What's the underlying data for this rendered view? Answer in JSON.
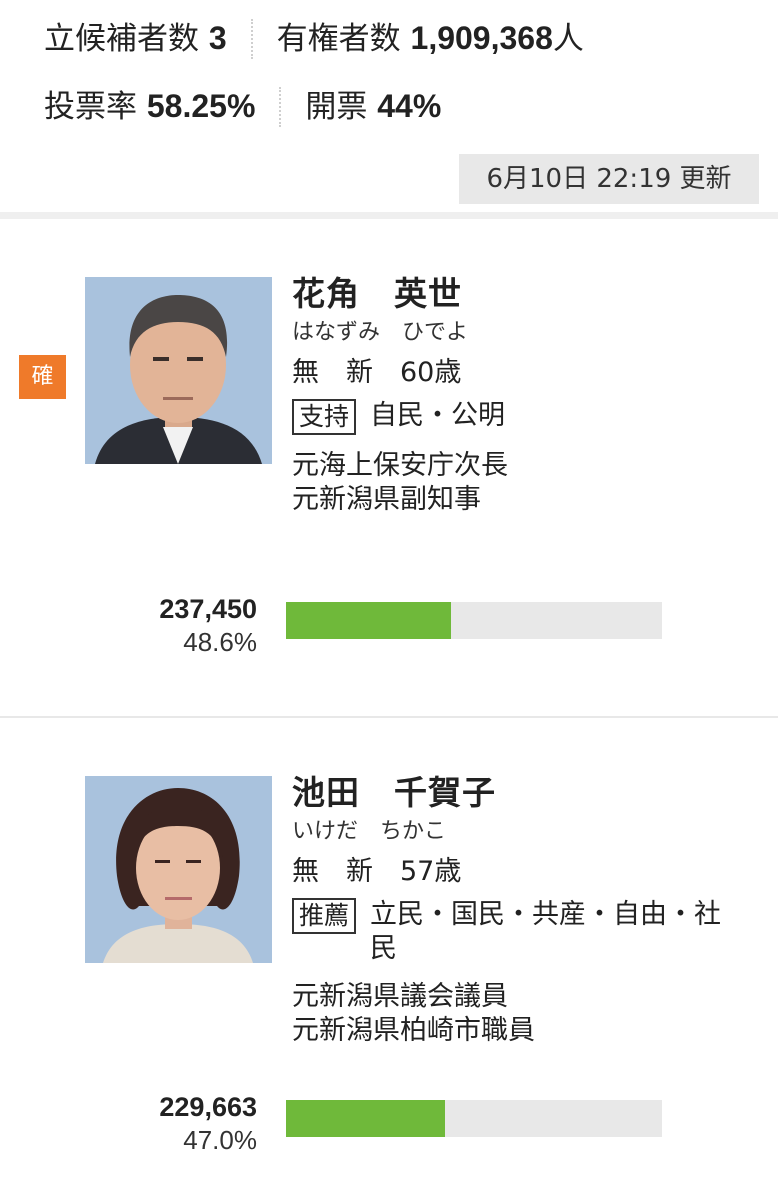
{
  "stats": {
    "candidates_label": "立候補者数",
    "candidates_value": "3",
    "voters_label": "有権者数",
    "voters_value": "1,909,368",
    "voters_unit": "人",
    "turnout_label": "投票率",
    "turnout_value": "58.25%",
    "counted_label": "開票",
    "counted_value": "44%"
  },
  "updated": "6月10日 22:19 更新",
  "candidates": [
    {
      "badge": "確",
      "name": "花角　英世",
      "kana": "はなずみ　ひでよ",
      "status": "無　新　60歳",
      "support_tag": "支持",
      "support_parties": "自民・公明",
      "career": [
        "元海上保安庁次長",
        "元新潟県副知事"
      ],
      "votes": "237,450",
      "percent": "48.6%",
      "share": 0.4387
    },
    {
      "name": "池田　千賀子",
      "kana": "いけだ　ちかこ",
      "status": "無　新　57歳",
      "support_tag": "推薦",
      "support_parties": "立民・国民・共産・自由・社民",
      "career": [
        "元新潟県議会議員",
        "元新潟県柏崎市職員"
      ],
      "votes": "229,663",
      "percent": "47.0%",
      "share": 0.4229
    }
  ]
}
